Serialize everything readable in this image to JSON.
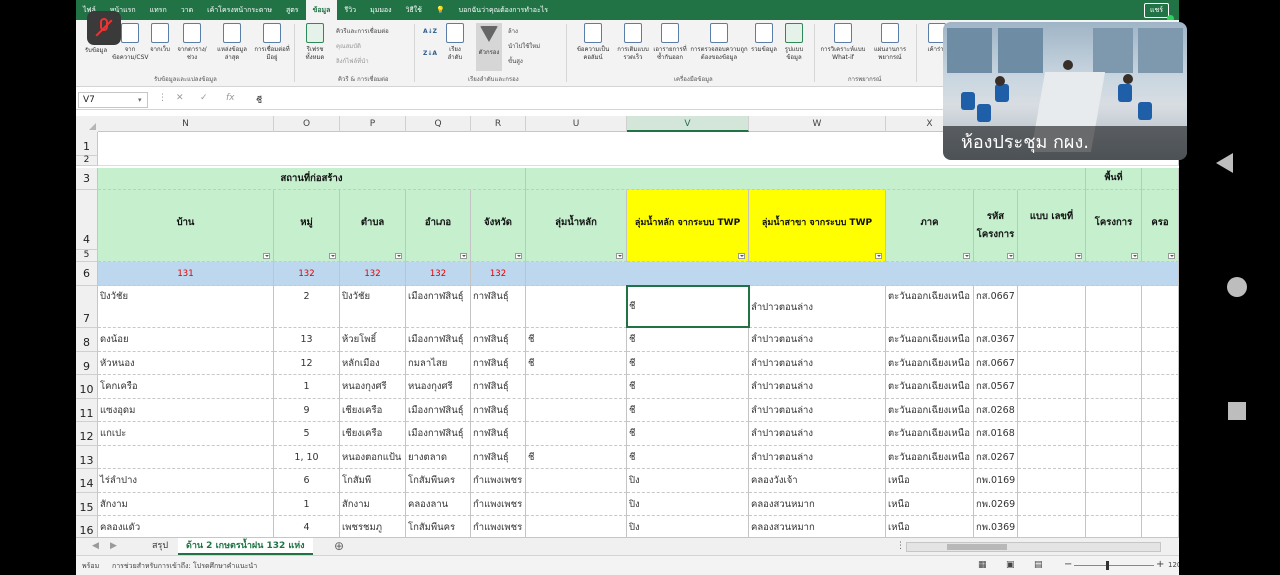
{
  "ribbon": {
    "tabs": [
      "ไฟล์",
      "หน้าแรก",
      "แทรก",
      "วาด",
      "เค้าโครงหน้ากระดาษ",
      "สูตร",
      "ข้อมูล",
      "รีวิว",
      "มุมมอง",
      "วิธีใช้"
    ],
    "active_tab": "ข้อมูล",
    "tell_me": "บอกฉันว่าคุณต้องการทำอะไร",
    "share": "แชร์",
    "buttons": {
      "get_data": "รับข้อมูล",
      "from_text": "จากข้อความ/CSV",
      "from_web": "จากเว็บ",
      "from_table": "จากตาราง/ช่วง",
      "recent_sources": "แหล่งข้อมูลล่าสุด",
      "existing_conn": "การเชื่อมต่อที่มีอยู่",
      "refresh_all": "รีเฟรชทั้งหมด",
      "queries_conn": "คิวรีและการเชื่อมต่อ",
      "properties": "คุณสมบัติ",
      "edit_links": "ลิงก์ไฟล์ที่นำ",
      "sort": "เรียงลำดับ",
      "filter": "ตัวกรอง",
      "clear": "ล้าง",
      "reapply": "นำไปใช้ใหม่",
      "advanced": "ขั้นสูง",
      "text_to_columns": "ข้อความเป็นคอลัมน์",
      "flash_fill": "การเติมแบบรวดเร็ว",
      "remove_dup": "เอารายการที่ซ้ำกันออก",
      "data_validation": "การตรวจสอบความถูกต้องของข้อมูล",
      "consolidate": "รวมข้อมูล",
      "data_model": "รูปแบบข้อมูล",
      "what_if": "การวิเคราะห์แบบ What-if",
      "forecast": "แผ่นงานการพยากรณ์",
      "outline": "เค้าร่าง"
    },
    "groups": {
      "get_transform": "รับข้อมูลและแปลงข้อมูล",
      "queries": "คิวรี & การเชื่อมต่อ",
      "sort_filter": "เรียงลำดับและกรอง",
      "data_tools": "เครื่องมือข้อมูล",
      "forecast": "การพยากรณ์"
    }
  },
  "formula_bar": {
    "name_box": "V7",
    "content": "ชี"
  },
  "columns": [
    "N",
    "O",
    "P",
    "Q",
    "R",
    "U",
    "V",
    "W",
    "X"
  ],
  "header": {
    "group_label": "สถานที่ก่อสร้าง",
    "ban": "บ้าน",
    "mu": "หมู่",
    "tambon": "ตำบล",
    "amphoe": "อำเภอ",
    "changwat": "จังหวัด",
    "basin_main": "ลุ่มน้ำหลัก",
    "basin_twp": "ลุ่มน้ำหลัก จากระบบ TWP",
    "subbasin_twp": "ลุ่มน้ำสาขา จากระบบ TWP",
    "region": "ภาค",
    "project_code": "รหัส โครงการ",
    "form_no": "แบบ เลขที่",
    "area_top": "พื้นที่",
    "project": "โครงการ",
    "cover": "ครอ"
  },
  "row6_counts": [
    "131",
    "132",
    "132",
    "132",
    "132"
  ],
  "rows": [
    {
      "n": "7",
      "ban": "ปิงวัชัย",
      "mu": "2",
      "tambon": "ปิงวัชัย",
      "amphoe": "เมืองกาฬสินธุ์",
      "changwat": "กาฬสินธุ์",
      "basin": "",
      "twp": "ชี",
      "sub": "ลำปาวตอนล่าง",
      "region": "ตะวันออกเฉียงเหนือ",
      "code": "กส.0667"
    },
    {
      "n": "8",
      "ban": "ดงน้อย",
      "mu": "13",
      "tambon": "ห้วยโพธิ์",
      "amphoe": "เมืองกาฬสินธุ์",
      "changwat": "กาฬสินธุ์",
      "basin": "ชี",
      "twp": "ชี",
      "sub": "ลำปาวตอนล่าง",
      "region": "ตะวันออกเฉียงเหนือ",
      "code": "กส.0367"
    },
    {
      "n": "9",
      "ban": "หัวหนอง",
      "mu": "12",
      "tambon": "หลักเมือง",
      "amphoe": "กมลาไสย",
      "changwat": "กาฬสินธุ์",
      "basin": "ชี",
      "twp": "ชี",
      "sub": "ลำปาวตอนล่าง",
      "region": "ตะวันออกเฉียงเหนือ",
      "code": "กส.0667"
    },
    {
      "n": "10",
      "ban": "โคกเครือ",
      "mu": "1",
      "tambon": "หนองกุงศรี",
      "amphoe": "หนองกุงศรี",
      "changwat": "กาฬสินธุ์",
      "basin": "",
      "twp": "ชี",
      "sub": "ลำปาวตอนล่าง",
      "region": "ตะวันออกเฉียงเหนือ",
      "code": "กส.0567"
    },
    {
      "n": "11",
      "ban": "แซงอุดม",
      "mu": "9",
      "tambon": "เชียงเครือ",
      "amphoe": "เมืองกาฬสินธุ์",
      "changwat": "กาฬสินธุ์",
      "basin": "",
      "twp": "ชี",
      "sub": "ลำปาวตอนล่าง",
      "region": "ตะวันออกเฉียงเหนือ",
      "code": "กส.0268"
    },
    {
      "n": "12",
      "ban": "แกเปะ",
      "mu": "5",
      "tambon": "เชียงเครือ",
      "amphoe": "เมืองกาฬสินธุ์",
      "changwat": "กาฬสินธุ์",
      "basin": "",
      "twp": "ชี",
      "sub": "ลำปาวตอนล่าง",
      "region": "ตะวันออกเฉียงเหนือ",
      "code": "กส.0168"
    },
    {
      "n": "13",
      "ban": "",
      "mu": "1, 10",
      "tambon": "หนองตอกแป้น",
      "amphoe": "ยางตลาด",
      "changwat": "กาฬสินธุ์",
      "basin": "ชี",
      "twp": "ชี",
      "sub": "ลำปาวตอนล่าง",
      "region": "ตะวันออกเฉียงเหนือ",
      "code": "กส.0267"
    },
    {
      "n": "14",
      "ban": "ไร่ลำปาง",
      "mu": "6",
      "tambon": "โกสัมพี",
      "amphoe": "โกสัมพีนคร",
      "changwat": "กำแพงเพชร",
      "basin": "",
      "twp": "ปิง",
      "sub": "คลองวังเจ้า",
      "region": "เหนือ",
      "code": "กพ.0169"
    },
    {
      "n": "15",
      "ban": "สักงาม",
      "mu": "1",
      "tambon": "สักงาม",
      "amphoe": "คลองลาน",
      "changwat": "กำแพงเพชร",
      "basin": "",
      "twp": "ปิง",
      "sub": "คลองสวนหมาก",
      "region": "เหนือ",
      "code": "กพ.0269"
    },
    {
      "n": "16",
      "ban": "คลองแดัว",
      "mu": "4",
      "tambon": "เพชรชมภู",
      "amphoe": "โกสัมพีนคร",
      "changwat": "กำแพงเพชร",
      "basin": "",
      "twp": "ปิง",
      "sub": "คลองสวนหมาก",
      "region": "เหนือ",
      "code": "กพ.0369"
    }
  ],
  "sheet_tabs": [
    "สรุป",
    "ด้าน 2 เกษตรน้ำฝน 132 แห่ง"
  ],
  "active_sheet": "ด้าน 2 เกษตรน้ำฝน 132 แห่ง",
  "status": {
    "ready": "พร้อม",
    "accessibility": "การช่วยสำหรับการเข้าถึง: โปรดศึกษาคำแนะนำ",
    "zoom": "120%"
  },
  "video": {
    "label": "ห้องประชุม กผง."
  }
}
